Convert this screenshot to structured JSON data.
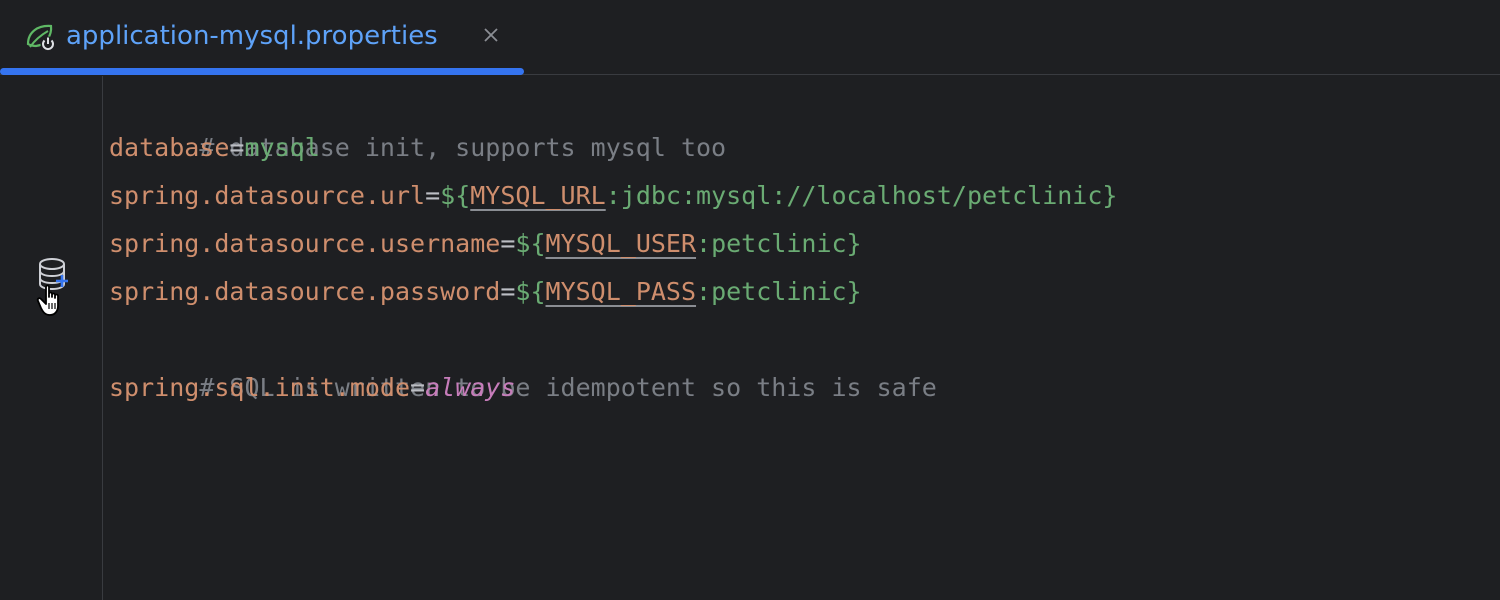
{
  "tab": {
    "label": "application-mysql.properties",
    "icon": "spring-properties-icon",
    "close_icon": "close-icon",
    "active_color": "#3574f0"
  },
  "gutter": {
    "icon": "database-add-icon",
    "cursor": "hand-pointer-cursor"
  },
  "colors": {
    "background": "#1e1f22",
    "comment": "#7a7e85",
    "key": "#cf8e6d",
    "value": "#6aab73",
    "enum": "#c77dbb"
  },
  "editor": {
    "line1": {
      "text": "# database init, supports mysql too"
    },
    "line2": {
      "key": "database",
      "eq": "=",
      "value": "mysql"
    },
    "line3": {
      "key": "spring.datasource.url",
      "eq": "=",
      "open": "${",
      "placeholder": "MYSQL_URL",
      "rest": ":jdbc:mysql://localhost/petclinic}"
    },
    "line4": {
      "key": "spring.datasource.username",
      "eq": "=",
      "open": "${",
      "placeholder": "MYSQL_USER",
      "rest": ":petclinic}"
    },
    "line5": {
      "key": "spring.datasource.password",
      "eq": "=",
      "open": "${",
      "placeholder": "MYSQL_PASS",
      "rest": ":petclinic}"
    },
    "line6": {
      "text": "# SQL is written to be idempotent so this is safe"
    },
    "line7": {
      "key": "spring.sql.init.mode",
      "eq": "=",
      "value": "always"
    }
  }
}
